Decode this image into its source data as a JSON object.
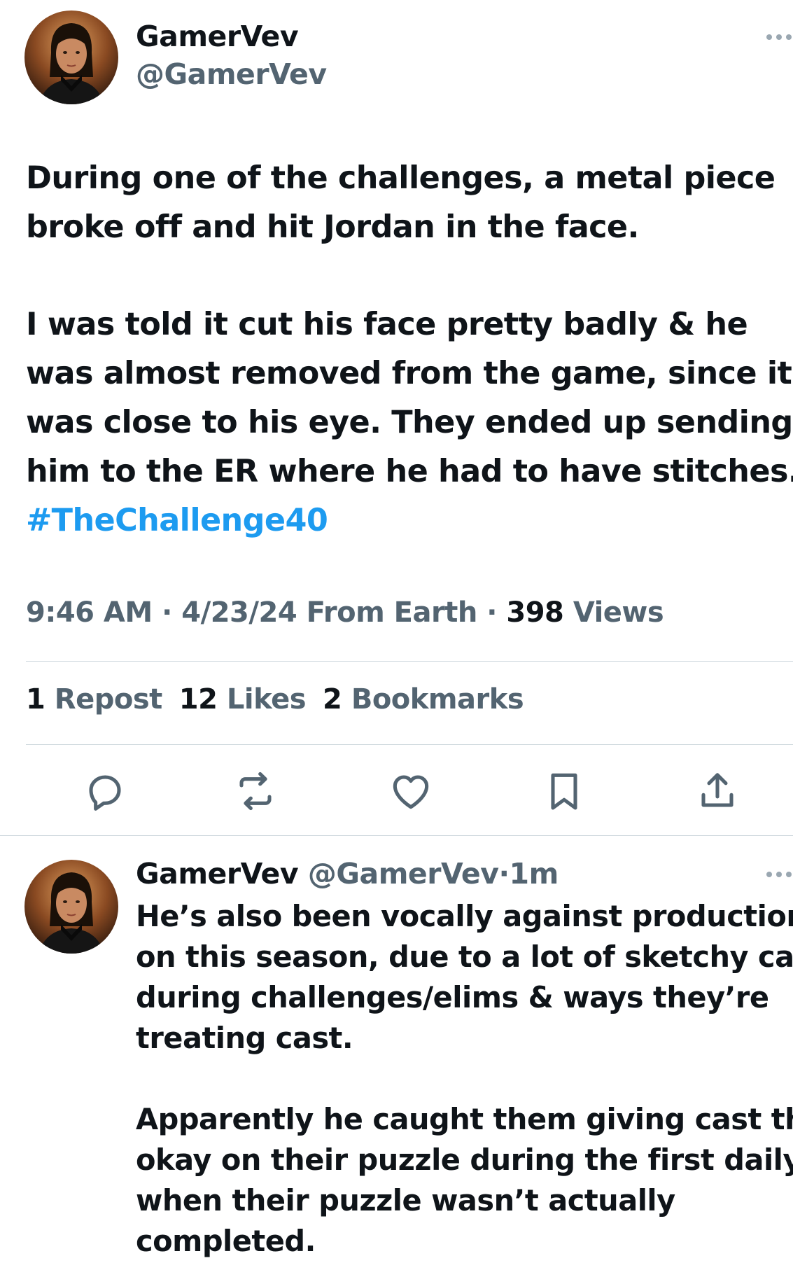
{
  "tweet": {
    "author_name": "GamerVev",
    "author_handle": "@GamerVev",
    "paragraph1": [
      "During one of the challenges, a metal piece",
      "broke off and hit Jordan in the face."
    ],
    "paragraph2": [
      "I was told it cut his face pretty badly & he",
      "was almost removed from the game, since it",
      "was close to his eye. They ended up sending",
      "him to the ER where he had to have stitches."
    ],
    "hashtag": "#TheChallenge40",
    "time": "9:46 AM",
    "date": "4/23/24",
    "location": "From Earth",
    "views_count": "398",
    "views_label": "Views",
    "separator": "·",
    "stats": {
      "reposts_count": "1",
      "reposts_label": "Repost",
      "likes_count": "12",
      "likes_label": "Likes",
      "bookmarks_count": "2",
      "bookmarks_label": "Bookmarks"
    },
    "actions": [
      "reply-icon",
      "repost-icon",
      "like-icon",
      "bookmark-icon",
      "share-icon"
    ]
  },
  "reply": {
    "author_name": "GamerVev",
    "author_handle": "@GamerVev",
    "separator": "·",
    "time_ago": "1m",
    "paragraph1": [
      "He’s also been vocally against production",
      "on this season, due to a lot of sketchy calls",
      "during challenges/elims & ways they’re",
      "treating cast."
    ],
    "paragraph2": [
      "Apparently he caught them giving cast the",
      "okay on their puzzle during the first daily,",
      "when their puzzle wasn’t actually",
      "completed."
    ]
  },
  "colors": {
    "text": "#0f1419",
    "secondary": "#536471",
    "link": "#1d9bf0",
    "divider": "#cfd9de"
  }
}
